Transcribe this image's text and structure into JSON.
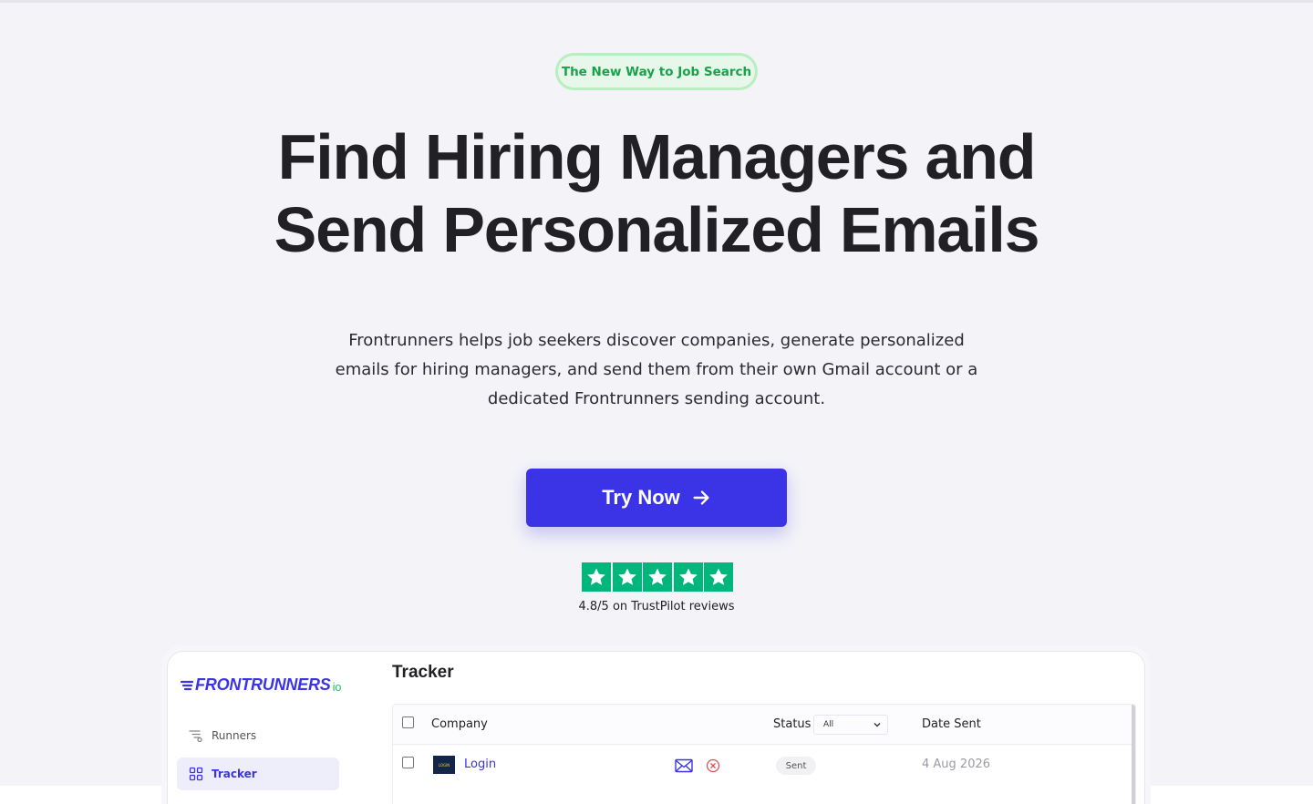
{
  "hero": {
    "badge": "The New Way to Job Search",
    "headline_line1": "Find Hiring Managers and",
    "headline_line2": "Send Personalized Emails",
    "subtext": "Frontrunners helps job seekers discover companies, generate personalized emails for hiring managers, and send them from their own Gmail account or a dedicated Frontrunners sending account.",
    "cta_label": "Try Now",
    "cta_icon": "arrow-right-icon",
    "rating_stars": 5,
    "rating_text": "4.8/5 on TrustPilot reviews"
  },
  "colors": {
    "brand": "#3b34e6",
    "badge_green": "#16a34a",
    "trustpilot_green": "#00b67a"
  },
  "app_preview": {
    "logo": "FRONTRUNNERS",
    "logo_suffix": "io",
    "sidebar": [
      {
        "label": "Runners",
        "icon": "runners-icon",
        "active": false
      },
      {
        "label": "Tracker",
        "icon": "grid-icon",
        "active": true
      }
    ],
    "title": "Tracker",
    "table": {
      "columns": [
        "Company",
        "Status",
        "Date Sent"
      ],
      "status_filter": "All",
      "rows": [
        {
          "company": "Login",
          "status": "Sent",
          "date": "4 Aug 2026",
          "logo_text": "LOGIN"
        }
      ]
    }
  }
}
